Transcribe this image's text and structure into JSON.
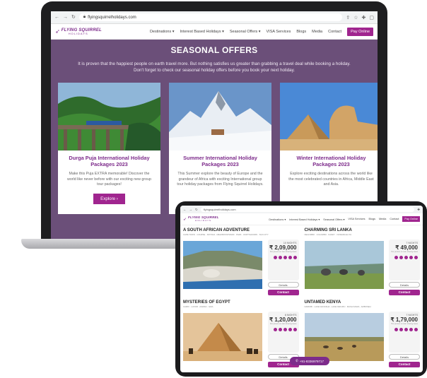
{
  "laptop": {
    "url": "flyingsquirrelholidays.com",
    "logo": {
      "main": "FLYING SQUIRREL",
      "sub": "HOLIDAYS"
    },
    "nav": [
      "Destinations ▾",
      "Interest Based Holidays ▾",
      "Seasonal Offers ▾",
      "VISA Services",
      "Blogs",
      "Media",
      "Contact"
    ],
    "pay_online": "Pay Online",
    "section_title": "SEASONAL OFFERS",
    "intro": "It is proven that the happiest people on earth travel more. But nothing satisfies us greater than grabbing a travel deal while booking a holiday. Don't forget to check our seasonal holiday offers before you book your next holiday.",
    "cards": [
      {
        "title": "Durga Puja International Holiday Packages 2023",
        "text": "Make this Puja EXTRA memorable! Discover the world like never before with our exciting new group tour packages!",
        "button": "Explore ›"
      },
      {
        "title": "Summer International Holiday Packages 2023",
        "text": "This Summer explore the beauty of Europe and the grandeur of Africa with exciting International group tour holiday packages from Flying Squirrel Holidays.",
        "button": ""
      },
      {
        "title": "Winter International Holiday Packages 2023",
        "text": "Explore exciting destinations across the world like the most celebrated countries in Africa, Middle East and Asia.",
        "button": ""
      }
    ]
  },
  "tablet": {
    "url": "flyingsquirrelholidays.com",
    "nav": [
      "Destinations ▾",
      "Interest Based Holidays ▾",
      "Seasonal Offers ▾",
      "VISA Services",
      "Blogs",
      "Media",
      "Contact"
    ],
    "pay_online": "Pay Online",
    "packages": [
      {
        "title": "A SOUTH AFRICAN ADVENTURE",
        "route": "CAPE TOWN · COURSE · KRYSNA · MELKBOSSTRAND · PARK · OUDTSHOORN · SUN CITY",
        "nights": "10 NIGHTS",
        "price": "₹ 2,09,000",
        "note": "Per person on twin sharing basis",
        "details": "Details",
        "contact": "Contact"
      },
      {
        "title": "CHARMING SRI LANKA",
        "route": "NEGOMBO · COLOMBO · KANDY · NUWARA ELIYA",
        "nights": "7 NIGHTS",
        "price": "₹ 49,000",
        "note": "Per person on twin sharing basis",
        "details": "Details",
        "contact": "Contact"
      },
      {
        "title": "MYSTERIES OF EGYPT",
        "route": "CAIRO · LUXOR · ASWAN · GIZA",
        "nights": "8 NIGHTS",
        "price": "₹ 1,20,000",
        "note": "Per person on twin sharing basis",
        "details": "Details",
        "contact": "Contact"
      },
      {
        "title": "UNTAMED KENYA",
        "route": "NAIROBI · LAKE NAIVASHA · LAKE NAKURU · MASAI MARA · AMBOSELI",
        "nights": "7 NIGHTS",
        "price": "₹ 1,79,000",
        "note": "Per person on twin sharing basis",
        "details": "Details",
        "contact": "Contact"
      }
    ],
    "whatsapp": "+91-8336979717"
  },
  "colors": {
    "brand": "#a0258f",
    "section_bg": "#6b4f79"
  }
}
